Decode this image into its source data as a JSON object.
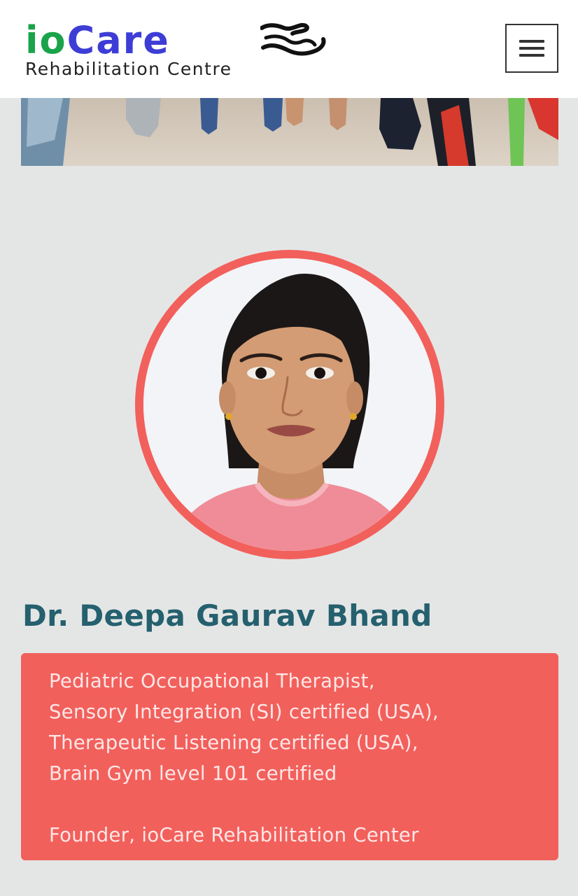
{
  "header": {
    "logo": {
      "brand_io": "io",
      "brand_care": "Care",
      "subtitle": "Rehabilitation Centre",
      "mark_icon": "hands-icon"
    },
    "menu_icon": "hamburger-icon"
  },
  "banner": {
    "image": "children-feet-photo"
  },
  "profile": {
    "photo": "doctor-portrait",
    "name": "Dr. Deepa Gaurav Bhand",
    "bio_lines": [
      "Pediatric Occupational Therapist,",
      "Sensory Integration (SI) certified (USA),",
      "Therapeutic Listening certified (USA),",
      "Brain Gym level 101 certified"
    ],
    "role": "Founder, ioCare Rehabilitation Center"
  },
  "colors": {
    "accent": "#f2605c",
    "name_color": "#25606e",
    "logo_green": "#1aa34a",
    "logo_blue": "#3d3dd6",
    "page_bg": "#e4e6e6"
  }
}
